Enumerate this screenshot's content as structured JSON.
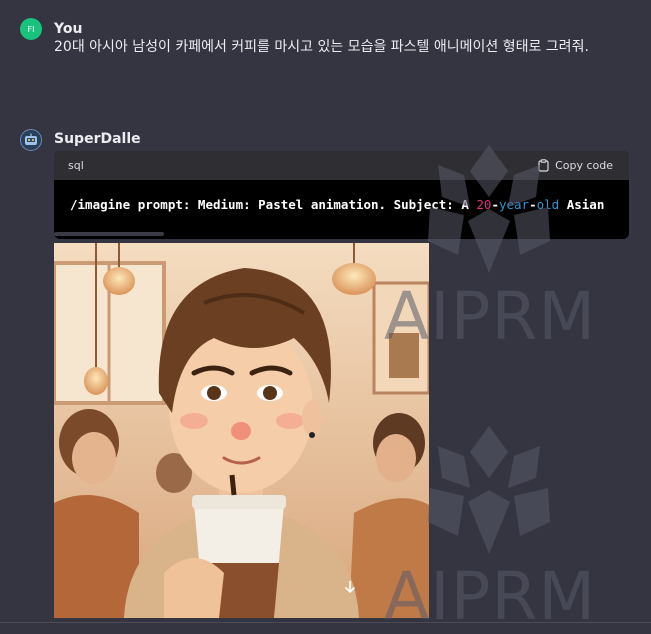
{
  "user_message": {
    "avatar_initials": "FI",
    "author": "You",
    "text": "20대 아시아 남성이 카페에서 커피를 마시고 있는 모습을 파스텔 애니메이션 형태로 그려줘."
  },
  "bot_message": {
    "author": "SuperDalle",
    "code": {
      "language": "sql",
      "copy_label": "Copy code",
      "line_prefix": "/imagine prompt: Medium: Pastel animation. Subject: A ",
      "num": "20",
      "dash1": "-",
      "kw1": "year",
      "dash2": "-",
      "kw2": "old",
      "line_suffix": " Asian"
    },
    "image_icon": "generated-cafe-illustration",
    "download_icon": "download-arrow-icon"
  },
  "watermark": {
    "text": "AIPRM",
    "icon": "aiprm-logo-icon"
  },
  "colors": {
    "background": "#343541",
    "user_avatar": "#19c37d",
    "code_number": "#df3079",
    "code_keyword": "#2e95d3"
  }
}
